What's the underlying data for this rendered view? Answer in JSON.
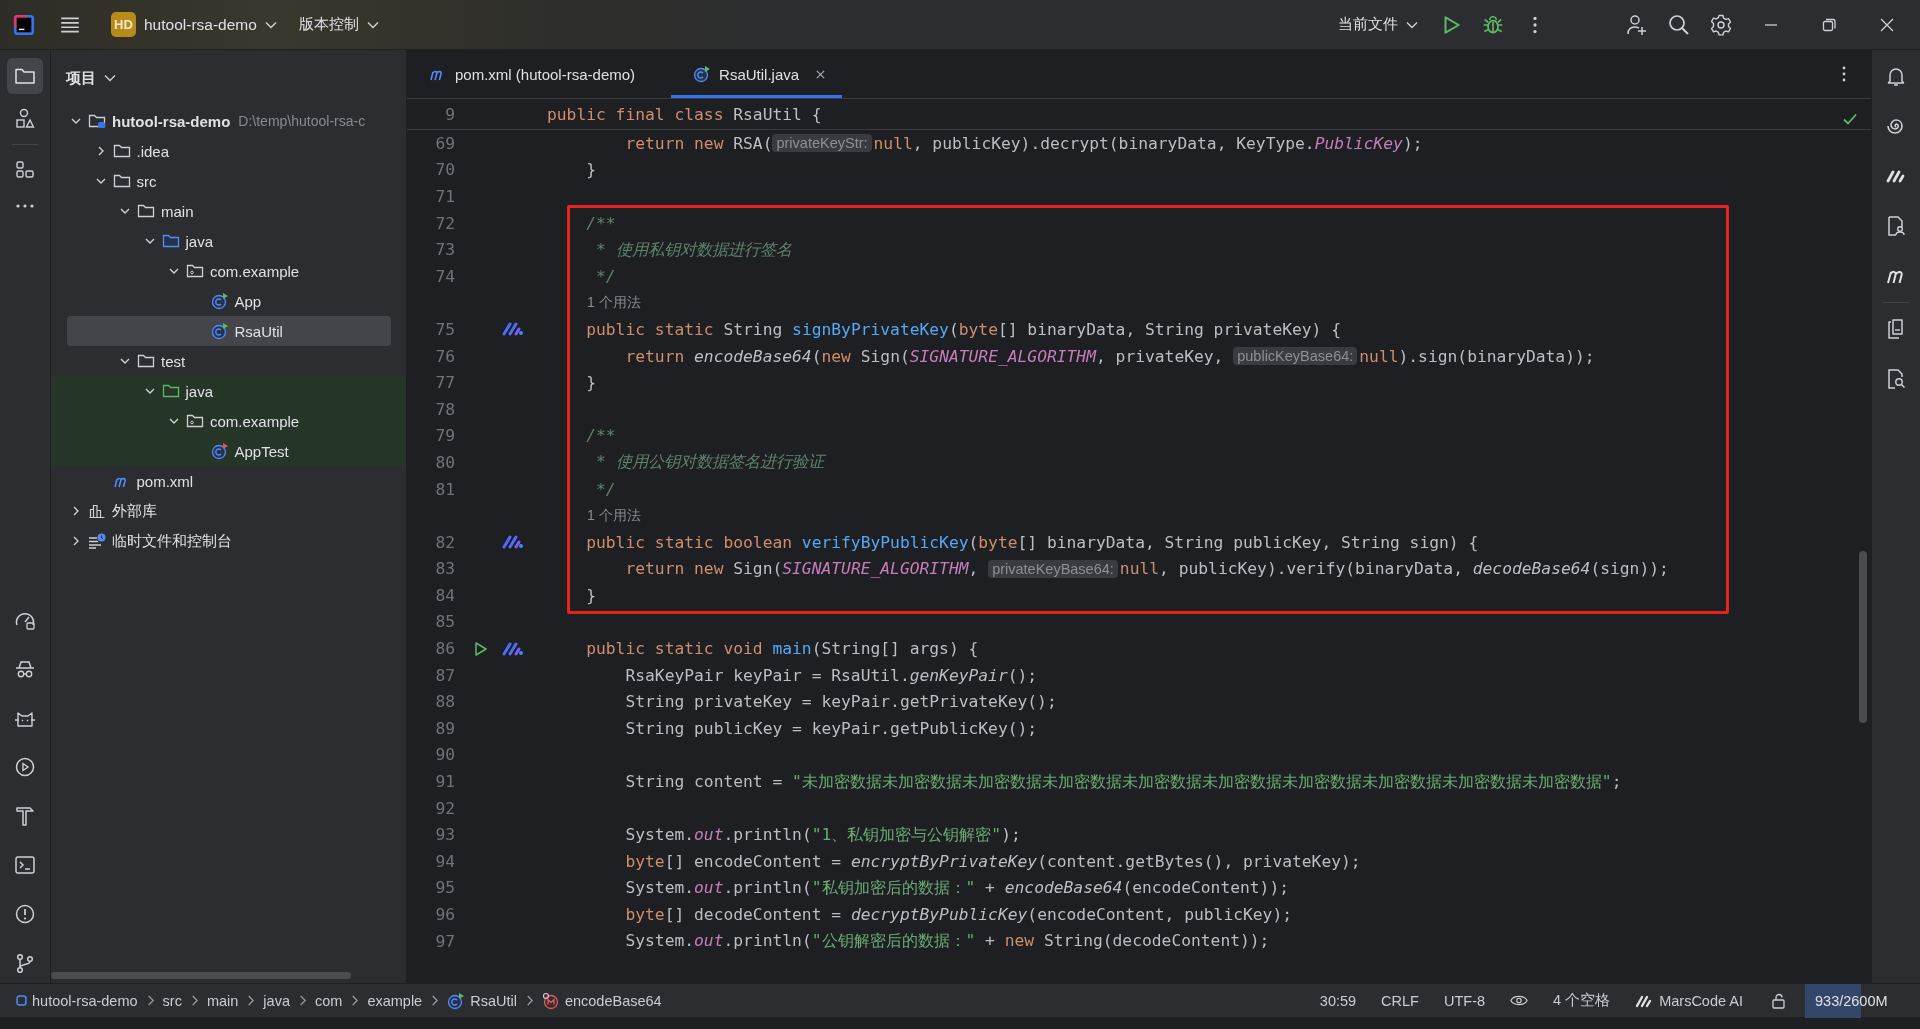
{
  "top_bar": {
    "project": {
      "badge": "HD",
      "name": "hutool-rsa-demo"
    },
    "vcs_menu": "版本控制",
    "run_config": "当前文件"
  },
  "project_panel": {
    "title": "项目",
    "tree": [
      {
        "label": "hutool-rsa-demo",
        "kind": "module",
        "path": "D:\\temp\\hutool-rsa-c",
        "expanded": true,
        "selected": false,
        "children": [
          {
            "label": ".idea",
            "kind": "folder",
            "expanded": false,
            "selected": false
          },
          {
            "label": "src",
            "kind": "folder",
            "expanded": true,
            "selected": false,
            "children": [
              {
                "label": "main",
                "kind": "folder",
                "expanded": true,
                "selected": false,
                "children": [
                  {
                    "label": "java",
                    "kind": "source_root",
                    "expanded": true,
                    "selected": false,
                    "children": [
                      {
                        "label": "com.example",
                        "kind": "package",
                        "expanded": true,
                        "selected": false,
                        "children": [
                          {
                            "label": "App",
                            "kind": "class",
                            "selected": false
                          },
                          {
                            "label": "RsaUtil",
                            "kind": "class",
                            "selected": true
                          }
                        ]
                      }
                    ]
                  }
                ]
              },
              {
                "label": "test",
                "kind": "folder",
                "expanded": true,
                "selected": false,
                "children": [
                  {
                    "label": "java",
                    "kind": "test_root",
                    "expanded": true,
                    "selected": false,
                    "children": [
                      {
                        "label": "com.example",
                        "kind": "package",
                        "expanded": true,
                        "selected": false,
                        "children": [
                          {
                            "label": "AppTest",
                            "kind": "test_class",
                            "selected": false
                          }
                        ]
                      }
                    ]
                  }
                ]
              }
            ]
          },
          {
            "label": "pom.xml",
            "kind": "maven",
            "selected": false
          }
        ]
      },
      {
        "label": "外部库",
        "kind": "libraries",
        "expanded": false,
        "selected": false
      },
      {
        "label": "临时文件和控制台",
        "kind": "scratches",
        "expanded": false,
        "selected": false
      }
    ]
  },
  "tabs": [
    {
      "label": "pom.xml (hutool-rsa-demo)",
      "kind": "maven",
      "selected": false,
      "closable": false
    },
    {
      "label": "RsaUtil.java",
      "kind": "class",
      "selected": true,
      "closable": true
    }
  ],
  "editor": {
    "sticky_line": {
      "number": "9",
      "tokens": [
        {
          "kind": "keyword",
          "text": "public final class "
        },
        {
          "kind": "plain",
          "text": "RsaUtil {"
        }
      ]
    },
    "rows": [
      {
        "kind": "line",
        "number": "69",
        "tokens": [
          {
            "kind": "keyword",
            "text": "        return new "
          },
          {
            "kind": "plain",
            "text": "RSA("
          },
          {
            "kind": "hint",
            "text": "privateKeyStr:"
          },
          {
            "kind": "keyword",
            "text": "null"
          },
          {
            "kind": "plain",
            "text": ", publicKey).decrypt(binaryData, KeyType."
          },
          {
            "kind": "constant",
            "text": "PublicKey"
          },
          {
            "kind": "plain",
            "text": ");"
          }
        ]
      },
      {
        "kind": "line",
        "number": "70",
        "tokens": [
          {
            "kind": "plain",
            "text": "    }"
          }
        ]
      },
      {
        "kind": "line",
        "number": "71"
      },
      {
        "kind": "annotation_box",
        "rows": [
          {
            "kind": "line",
            "number": "72",
            "tokens": [
              {
                "kind": "doc",
                "text": "    /**"
              }
            ]
          },
          {
            "kind": "line",
            "number": "73",
            "tokens": [
              {
                "kind": "doc",
                "text": "     * 使用私钥对数据进行签名"
              }
            ]
          },
          {
            "kind": "line",
            "number": "74",
            "tokens": [
              {
                "kind": "doc",
                "text": "     */"
              }
            ]
          },
          {
            "kind": "usage",
            "text": "1 个用法"
          },
          {
            "kind": "line",
            "number": "75",
            "ai_marker": true,
            "tokens": [
              {
                "kind": "keyword",
                "text": "    public static "
              },
              {
                "kind": "plain",
                "text": "String "
              },
              {
                "kind": "method",
                "text": "signByPrivateKey"
              },
              {
                "kind": "plain",
                "text": "("
              },
              {
                "kind": "keyword",
                "text": "byte"
              },
              {
                "kind": "plain",
                "text": "[] binaryData, String privateKey) {"
              }
            ]
          },
          {
            "kind": "line",
            "number": "76",
            "tokens": [
              {
                "kind": "keyword",
                "text": "        return "
              },
              {
                "kind": "call",
                "text": "encodeBase64"
              },
              {
                "kind": "plain",
                "text": "("
              },
              {
                "kind": "keyword",
                "text": "new "
              },
              {
                "kind": "plain",
                "text": "Sign("
              },
              {
                "kind": "constant",
                "text": "SIGNATURE_ALGORITHM"
              },
              {
                "kind": "plain",
                "text": ", privateKey, "
              },
              {
                "kind": "hint",
                "text": "publicKeyBase64:"
              },
              {
                "kind": "keyword",
                "text": "null"
              },
              {
                "kind": "plain",
                "text": ").sign(binaryData));"
              }
            ]
          },
          {
            "kind": "line",
            "number": "77",
            "tokens": [
              {
                "kind": "plain",
                "text": "    }"
              }
            ]
          },
          {
            "kind": "line",
            "number": "78"
          },
          {
            "kind": "line",
            "number": "79",
            "tokens": [
              {
                "kind": "doc",
                "text": "    /**"
              }
            ]
          },
          {
            "kind": "line",
            "number": "80",
            "tokens": [
              {
                "kind": "doc",
                "text": "     * 使用公钥对数据签名进行验证"
              }
            ]
          },
          {
            "kind": "line",
            "number": "81",
            "tokens": [
              {
                "kind": "doc",
                "text": "     */"
              }
            ]
          },
          {
            "kind": "usage",
            "text": "1 个用法"
          },
          {
            "kind": "line",
            "number": "82",
            "ai_marker": true,
            "tokens": [
              {
                "kind": "keyword",
                "text": "    public static boolean "
              },
              {
                "kind": "method",
                "text": "verifyByPublicKey"
              },
              {
                "kind": "plain",
                "text": "("
              },
              {
                "kind": "keyword",
                "text": "byte"
              },
              {
                "kind": "plain",
                "text": "[] binaryData, String publicKey, String sign) {"
              }
            ]
          },
          {
            "kind": "line",
            "number": "83",
            "tokens": [
              {
                "kind": "keyword",
                "text": "        return new "
              },
              {
                "kind": "plain",
                "text": "Sign("
              },
              {
                "kind": "constant",
                "text": "SIGNATURE_ALGORITHM"
              },
              {
                "kind": "plain",
                "text": ", "
              },
              {
                "kind": "hint",
                "text": "privateKeyBase64:"
              },
              {
                "kind": "keyword",
                "text": "null"
              },
              {
                "kind": "plain",
                "text": ", publicKey).verify(binaryData, "
              },
              {
                "kind": "call",
                "text": "decodeBase64"
              },
              {
                "kind": "plain",
                "text": "(sign));"
              }
            ]
          },
          {
            "kind": "line",
            "number": "84",
            "tokens": [
              {
                "kind": "plain",
                "text": "    }"
              }
            ]
          }
        ]
      },
      {
        "kind": "line",
        "number": "85"
      },
      {
        "kind": "line",
        "number": "86",
        "run_button": true,
        "ai_marker": true,
        "tokens": [
          {
            "kind": "keyword",
            "text": "    public static void "
          },
          {
            "kind": "method",
            "text": "main"
          },
          {
            "kind": "plain",
            "text": "(String[] args) {"
          }
        ]
      },
      {
        "kind": "line",
        "number": "87",
        "tokens": [
          {
            "kind": "plain",
            "text": "        RsaKeyPair keyPair = RsaUtil."
          },
          {
            "kind": "call",
            "text": "genKeyPair"
          },
          {
            "kind": "plain",
            "text": "();"
          }
        ]
      },
      {
        "kind": "line",
        "number": "88",
        "tokens": [
          {
            "kind": "plain",
            "text": "        String privateKey = keyPair.getPrivateKey();"
          }
        ]
      },
      {
        "kind": "line",
        "number": "89",
        "tokens": [
          {
            "kind": "plain",
            "text": "        String publicKey = keyPair.getPublicKey();"
          }
        ]
      },
      {
        "kind": "line",
        "number": "90"
      },
      {
        "kind": "line",
        "number": "91",
        "tokens": [
          {
            "kind": "plain",
            "text": "        String content = "
          },
          {
            "kind": "string",
            "text": "\"未加密数据未加密数据未加密数据未加密数据未加密数据未加密数据未加密数据未加密数据未加密数据未加密数据\""
          },
          {
            "kind": "plain",
            "text": ";"
          }
        ]
      },
      {
        "kind": "line",
        "number": "92"
      },
      {
        "kind": "line",
        "number": "93",
        "tokens": [
          {
            "kind": "plain",
            "text": "        System."
          },
          {
            "kind": "constant",
            "text": "out"
          },
          {
            "kind": "plain",
            "text": ".println("
          },
          {
            "kind": "string",
            "text": "\"1、私钥加密与公钥解密\""
          },
          {
            "kind": "plain",
            "text": ");"
          }
        ]
      },
      {
        "kind": "line",
        "number": "94",
        "tokens": [
          {
            "kind": "keyword",
            "text": "        byte"
          },
          {
            "kind": "plain",
            "text": "[] encodeContent = "
          },
          {
            "kind": "call",
            "text": "encryptByPrivateKey"
          },
          {
            "kind": "plain",
            "text": "(content.getBytes(), privateKey);"
          }
        ]
      },
      {
        "kind": "line",
        "number": "95",
        "tokens": [
          {
            "kind": "plain",
            "text": "        System."
          },
          {
            "kind": "constant",
            "text": "out"
          },
          {
            "kind": "plain",
            "text": ".println("
          },
          {
            "kind": "string",
            "text": "\"私钥加密后的数据：\""
          },
          {
            "kind": "plain",
            "text": " + "
          },
          {
            "kind": "call",
            "text": "encodeBase64"
          },
          {
            "kind": "plain",
            "text": "(encodeContent));"
          }
        ]
      },
      {
        "kind": "line",
        "number": "96",
        "tokens": [
          {
            "kind": "keyword",
            "text": "        byte"
          },
          {
            "kind": "plain",
            "text": "[] decodeContent = "
          },
          {
            "kind": "call",
            "text": "decryptByPublicKey"
          },
          {
            "kind": "plain",
            "text": "(encodeContent, publicKey);"
          }
        ]
      },
      {
        "kind": "line",
        "number": "97",
        "tokens": [
          {
            "kind": "plain",
            "text": "        System."
          },
          {
            "kind": "constant",
            "text": "out"
          },
          {
            "kind": "plain",
            "text": ".println("
          },
          {
            "kind": "string",
            "text": "\"公钥解密后的数据：\""
          },
          {
            "kind": "plain",
            "text": " + "
          },
          {
            "kind": "keyword",
            "text": "new "
          },
          {
            "kind": "plain",
            "text": "String(decodeContent));"
          }
        ]
      }
    ]
  },
  "status_bar": {
    "breadcrumbs": [
      {
        "label": "hutool-rsa-demo",
        "kind": "module"
      },
      {
        "label": "src",
        "kind": "folder"
      },
      {
        "label": "main",
        "kind": "folder"
      },
      {
        "label": "java",
        "kind": "folder"
      },
      {
        "label": "com",
        "kind": "folder"
      },
      {
        "label": "example",
        "kind": "folder"
      },
      {
        "label": "RsaUtil",
        "kind": "class"
      },
      {
        "label": "encodeBase64",
        "kind": "method"
      }
    ],
    "position": "30:59",
    "line_separator": "CRLF",
    "encoding": "UTF-8",
    "indent": "4 个空格",
    "ai_assistant": "MarsCode AI",
    "memory": {
      "text": "933/2600M",
      "level": 0.49
    }
  }
}
